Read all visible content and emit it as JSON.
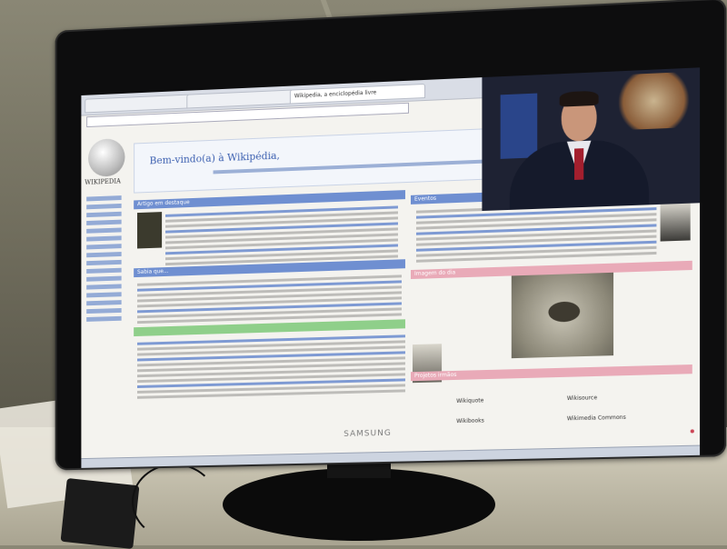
{
  "scene": {
    "monitor_brand": "SAMSUNG",
    "energy_logo": "energy-star",
    "screen": {
      "page_title": "Wikipedia, a enciclopédia livre",
      "welcome_text": "Bem-vindo(a) à Wikipédia,",
      "logo_text": "WIKIPEDIA",
      "sections": {
        "featured_article": "Artigo em destaque",
        "events": "Eventos",
        "image_of_day": "Imagem do dia",
        "sister_projects": "Projetos irmãos",
        "did_you_know": "Sabia que..."
      },
      "sister_links": [
        "Wikiquote",
        "Wikisource",
        "Wikibooks",
        "Wikimedia Commons"
      ],
      "video_overlay": "news-anchor"
    },
    "colors": {
      "section_blue": "#6f8fd1",
      "section_green": "#8fcf8a",
      "section_pink": "#e9aab8",
      "wiki_link": "#2f5fbf"
    },
    "icons": {
      "wiki_logo": "globe-puzzle-icon",
      "power": "power-led-icon"
    }
  }
}
